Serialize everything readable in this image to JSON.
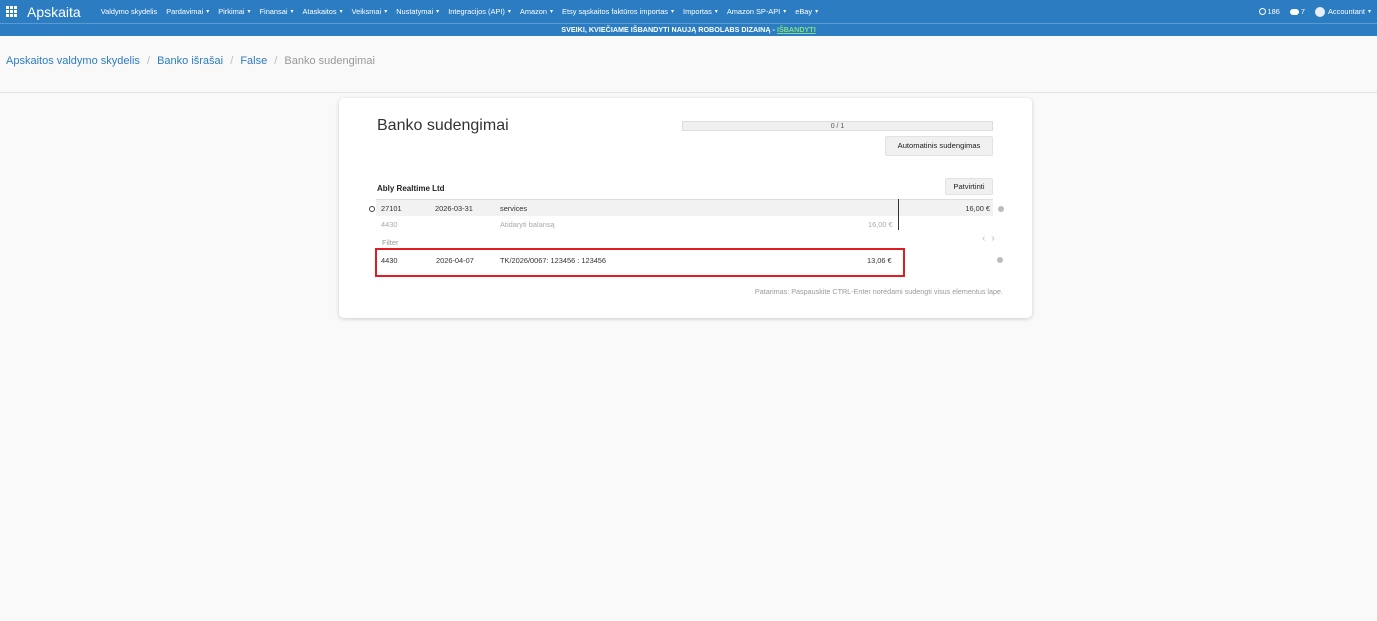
{
  "app": {
    "title": "Apskaita"
  },
  "nav": {
    "menu": [
      {
        "label": "Valdymo skydelis",
        "caret": false
      },
      {
        "label": "Pardavimai",
        "caret": true
      },
      {
        "label": "Pirkimai",
        "caret": true
      },
      {
        "label": "Finansai",
        "caret": true
      },
      {
        "label": "Ataskaitos",
        "caret": true
      },
      {
        "label": "Veiksmai",
        "caret": true
      },
      {
        "label": "Nustatymai",
        "caret": true
      },
      {
        "label": "Integracijos (API)",
        "caret": true
      },
      {
        "label": "Amazon",
        "caret": true
      },
      {
        "label": "Etsy sąskaitos faktūros importas",
        "caret": true
      },
      {
        "label": "Importas",
        "caret": true
      },
      {
        "label": "Amazon SP-API",
        "caret": true
      },
      {
        "label": "eBay",
        "caret": true
      }
    ],
    "right": {
      "activity_count": "186",
      "messages_count": "7",
      "user_label": "Accountant"
    }
  },
  "banner": {
    "text": "SVEIKI, KVIEČIAME IŠBANDYTI NAUJĄ ROBOLABS DIZAINĄ -",
    "link": "IŠBANDYTI"
  },
  "breadcrumb": {
    "items": [
      "Apskaitos valdymo skydelis",
      "Banko išrašai",
      "False"
    ],
    "active": "Banko sudengimai"
  },
  "card": {
    "title": "Banko sudengimai",
    "progress_text": "0 / 1",
    "progress_fraction": 0,
    "auto_button": "Automatinis sudengimas",
    "confirm_button": "Patvirtinti",
    "partner": "Ably Realtime Ltd",
    "statement_line": {
      "account": "27101",
      "date": "2026-03-31",
      "description": "services",
      "amount": "16,00 €"
    },
    "open_balance": {
      "account": "4430",
      "label": "Atidaryti balansą",
      "amount": "16,00 €"
    },
    "filter_label": "Filter",
    "proposition": {
      "account": "4430",
      "date": "2026-04-07",
      "reference": "TK/2026/0067: 123456 : 123456",
      "amount": "13,06 €"
    },
    "hint": "Patarimas: Paspauskite CTRL-Enter norėdami sudengti visus elementus lape."
  },
  "colors": {
    "navbar": "#2c7cc1",
    "highlight": "#e01b24",
    "banner_link": "#7fe07f"
  }
}
